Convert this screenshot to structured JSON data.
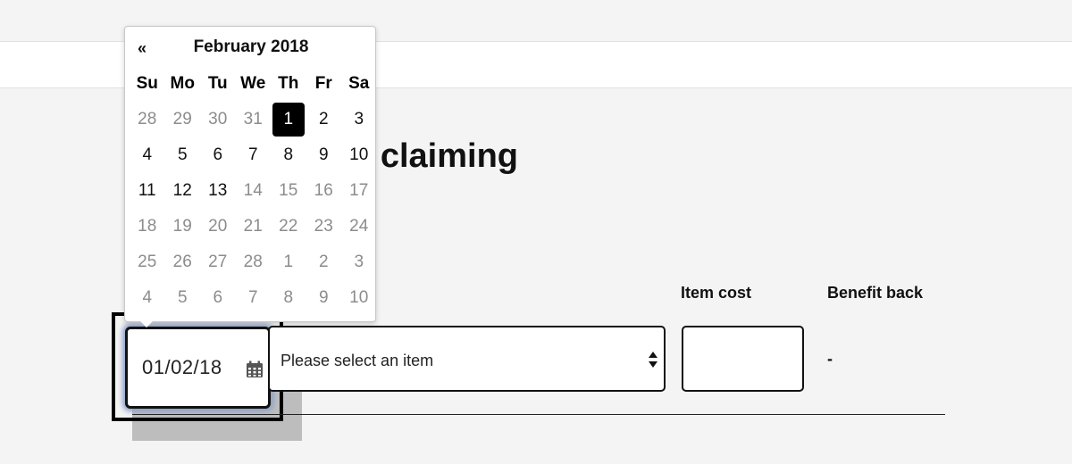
{
  "page": {
    "heading_fragment": "claiming"
  },
  "columns": {
    "item_cost_label": "Item cost",
    "benefit_back_label": "Benefit back"
  },
  "row": {
    "date_value": "01/02/18",
    "item_select_value": "Please select an item",
    "item_cost_value": "",
    "benefit_back_value": "-"
  },
  "calendar": {
    "prev_label": "«",
    "month_title": "February 2018",
    "weekdays": [
      "Su",
      "Mo",
      "Tu",
      "We",
      "Th",
      "Fr",
      "Sa"
    ],
    "weeks": [
      [
        {
          "d": "28",
          "m": true
        },
        {
          "d": "29",
          "m": true
        },
        {
          "d": "30",
          "m": true
        },
        {
          "d": "31",
          "m": true
        },
        {
          "d": "1",
          "s": true
        },
        {
          "d": "2"
        },
        {
          "d": "3"
        }
      ],
      [
        {
          "d": "4"
        },
        {
          "d": "5"
        },
        {
          "d": "6"
        },
        {
          "d": "7"
        },
        {
          "d": "8"
        },
        {
          "d": "9"
        },
        {
          "d": "10"
        }
      ],
      [
        {
          "d": "11"
        },
        {
          "d": "12"
        },
        {
          "d": "13"
        },
        {
          "d": "14",
          "m": true
        },
        {
          "d": "15",
          "m": true
        },
        {
          "d": "16",
          "m": true
        },
        {
          "d": "17",
          "m": true
        }
      ],
      [
        {
          "d": "18",
          "m": true
        },
        {
          "d": "19",
          "m": true
        },
        {
          "d": "20",
          "m": true
        },
        {
          "d": "21",
          "m": true
        },
        {
          "d": "22",
          "m": true
        },
        {
          "d": "23",
          "m": true
        },
        {
          "d": "24",
          "m": true
        }
      ],
      [
        {
          "d": "25",
          "m": true
        },
        {
          "d": "26",
          "m": true
        },
        {
          "d": "27",
          "m": true
        },
        {
          "d": "28",
          "m": true
        },
        {
          "d": "1",
          "m": true
        },
        {
          "d": "2",
          "m": true
        },
        {
          "d": "3",
          "m": true
        }
      ],
      [
        {
          "d": "4",
          "m": true
        },
        {
          "d": "5",
          "m": true
        },
        {
          "d": "6",
          "m": true
        },
        {
          "d": "7",
          "m": true
        },
        {
          "d": "8",
          "m": true
        },
        {
          "d": "9",
          "m": true
        },
        {
          "d": "10",
          "m": true
        }
      ]
    ]
  },
  "colors": {
    "selected_day_bg": "#000000",
    "focus_glow": "#8aa0c6",
    "muted_day": "#8c8c8c"
  },
  "icons": {
    "calendar": "calendar-icon",
    "select_arrows": "sort-arrows-icon"
  }
}
